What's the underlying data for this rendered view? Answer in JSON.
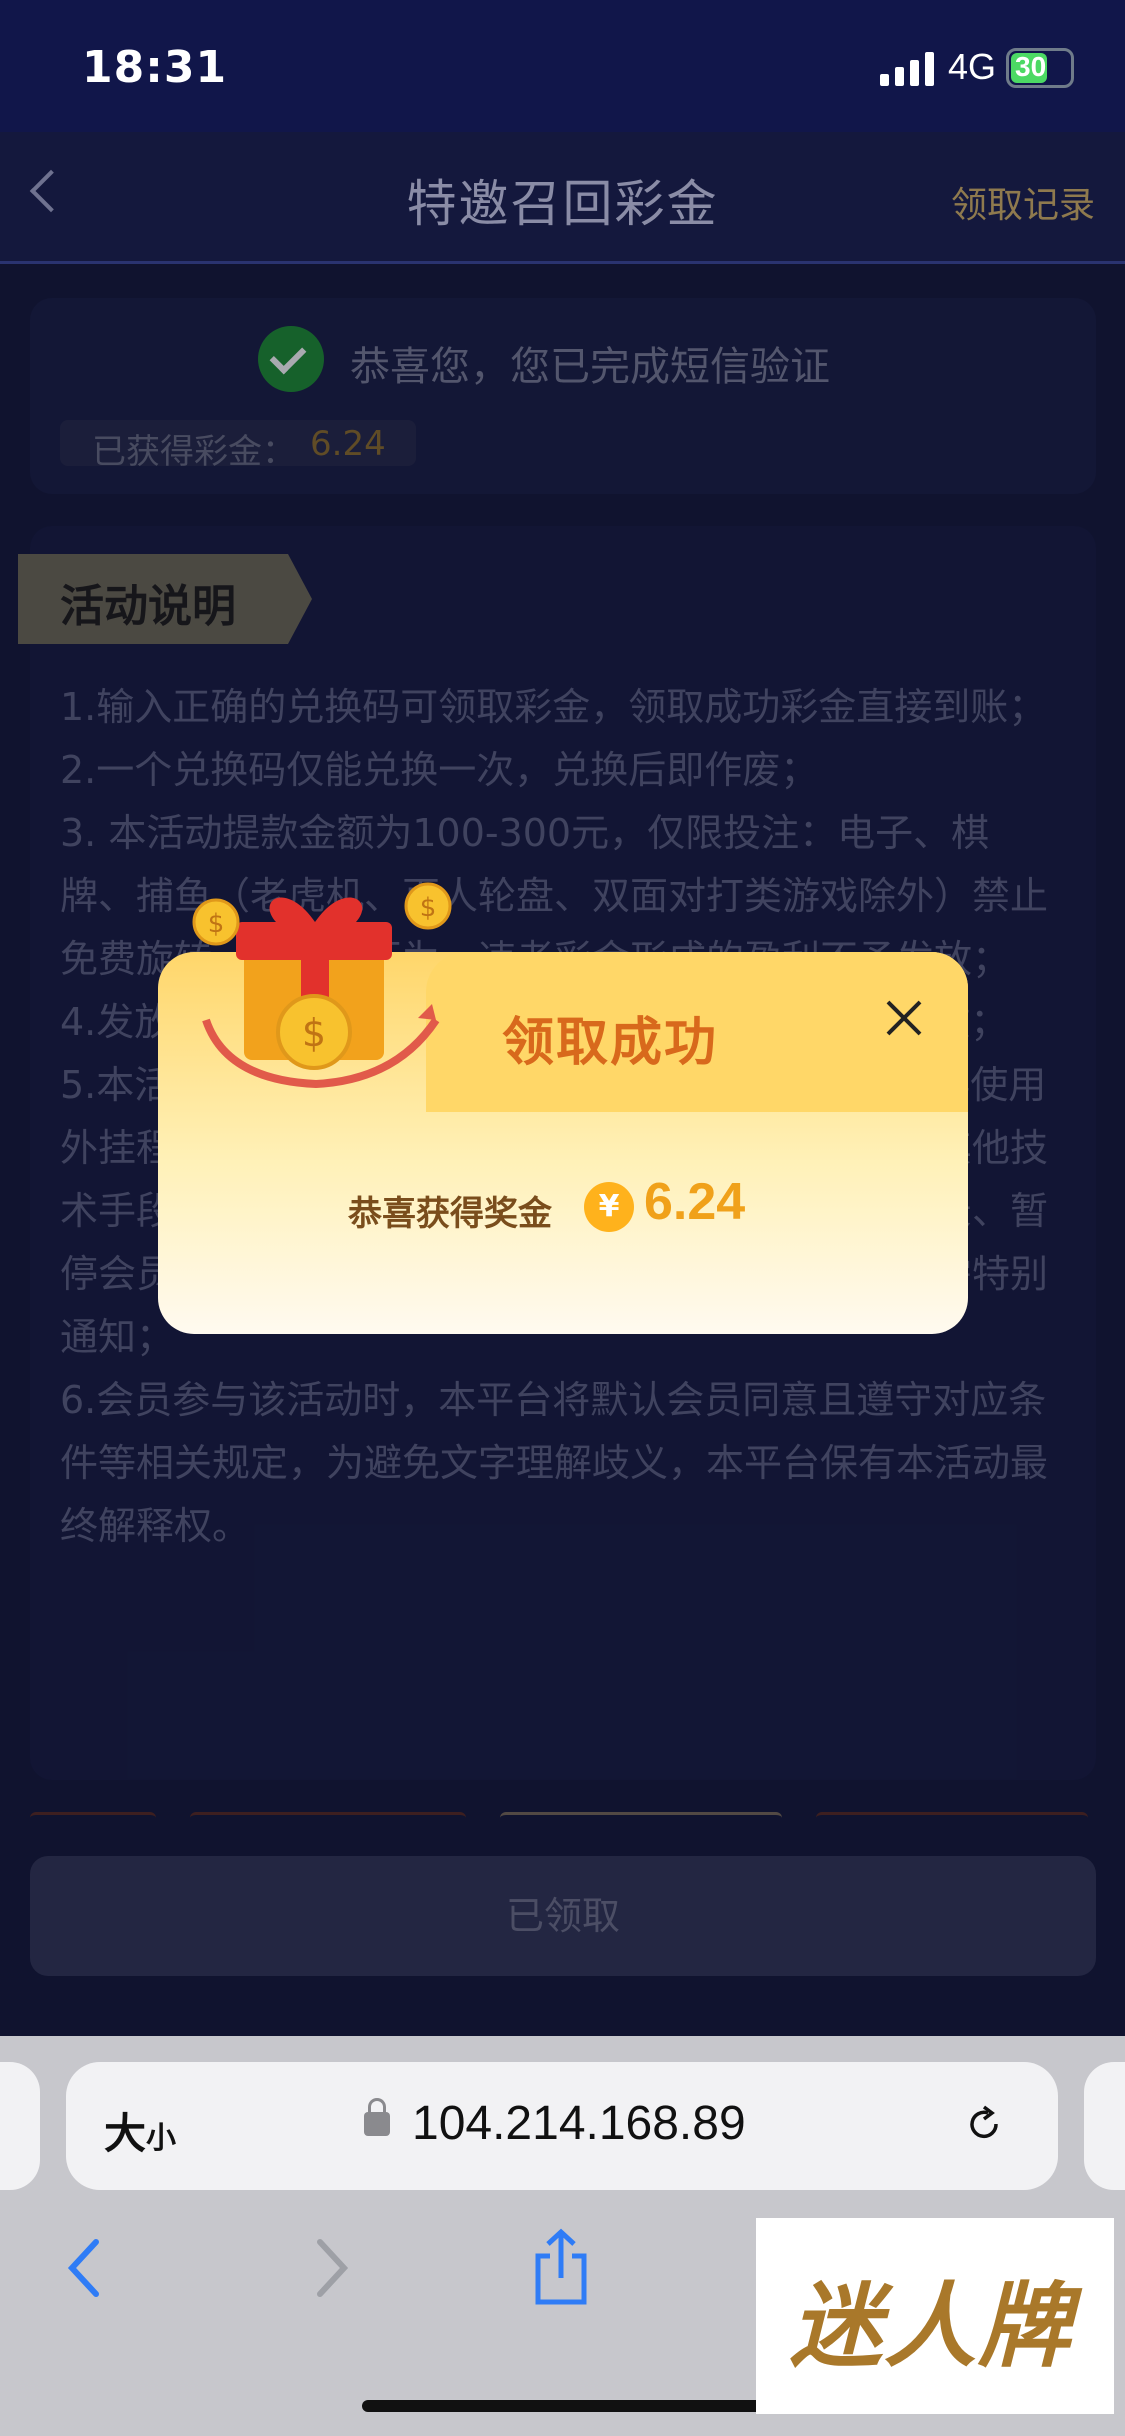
{
  "status": {
    "time": "18:31",
    "network": "4G",
    "battery": "30"
  },
  "nav": {
    "title": "特邀召回彩金",
    "record_link": "领取记录"
  },
  "verify": {
    "message": "恭喜您，您已完成短信验证",
    "earned_label": "已获得彩金：",
    "earned_value": "6.24"
  },
  "rules": {
    "tab_title": "活动说明",
    "text": "1.输入正确的兑换码可领取彩金，领取成功彩金直接到账；\n2.一个兑换码仅能兑换一次，兑换后即作废；\n3. 本活动提款金额为100-300元，仅限投注：电子、棋牌、捕鱼（老虎机、百人轮盘、双面对打类游戏除外）禁止免费旋转，套利等行为，违者彩金形成的盈利不予发放；\n4.发放彩金为限时活动，活动结束后，兑换码将会失效；\n5.本活动仅限真实会员参与，不得开设多个账号，不得使用外挂程式、机器人、利用协议、漏洞、接口、群控或其他技术手段参与，一经查核属实，本平台有权终止会员登录、暂停会员使用网站、及没收奖金和不当盈利的权利，无需特别通知；\n6.会员参与该活动时，本平台将默认会员同意且遵守对应条件等相关规定，为避免文字理解歧义，本平台保有本活动最终解释权。"
  },
  "claimed_button": "已领取",
  "browser": {
    "text_size": "大",
    "text_size_small": "小",
    "url": "104.214.168.89"
  },
  "watermark": "迷人牌",
  "modal": {
    "title": "领取成功",
    "reward_label": "恭喜获得奖金",
    "currency_symbol": "¥",
    "reward_value": "6.24"
  },
  "colors": {
    "accent": "#f0a11a",
    "modal_title": "#d8691c",
    "success": "#1e8f34"
  }
}
